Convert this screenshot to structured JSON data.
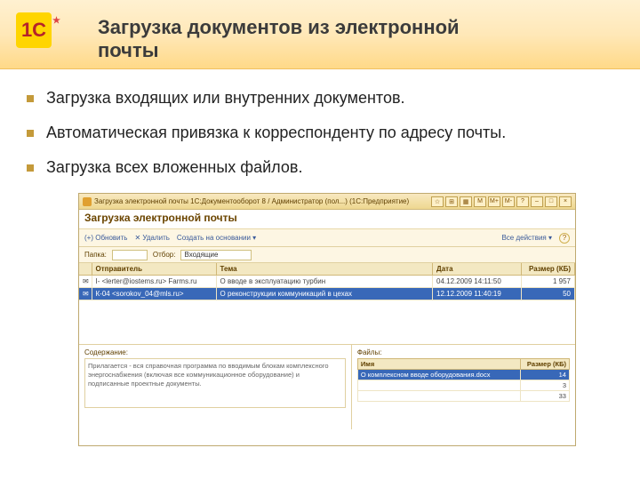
{
  "header": {
    "logo_text": "1С",
    "title_line1": "Загрузка документов из электронной",
    "title_line2": "почты"
  },
  "bullets": [
    "Загрузка входящих или внутренних документов.",
    "Автоматическая привязка к корреспонденту по адресу почты.",
    "Загрузка всех вложенных файлов."
  ],
  "screenshot": {
    "titlebar": "Загрузка электронной почты    1С:Документооборот 8 / Администратор (пол...)    (1С:Предприятие)",
    "titlebar_buttons": [
      "☆",
      "⊞",
      "▦",
      "M",
      "M+",
      "M-",
      "?",
      "–",
      "□",
      "×"
    ],
    "heading": "Загрузка электронной почты",
    "toolbar": {
      "btn1": "(+) Обновить",
      "btn2": "✕ Удалить",
      "btn3": "Создать на основании ▾",
      "right": "Все действия ▾"
    },
    "filter": {
      "label1": "Папка:",
      "label2": "Отбор:",
      "value2": "Входящие"
    },
    "columns": [
      "",
      "Отправитель",
      "Тема",
      "Дата",
      "Размер (КБ)"
    ],
    "rows": [
      {
        "icon": "✉",
        "from": "I- <lerter@iostems.ru> Farms.ru",
        "subj": "О вводе в эксплуатацию турбин",
        "date": "04.12.2009 14:11:50",
        "size": "1 957"
      },
      {
        "icon": "✉",
        "from": "К-04 <sorokov_04@mls.ru>",
        "subj": "О реконструкции коммуникаций в цехах",
        "date": "12.12.2009 11:40:19",
        "size": "50"
      }
    ],
    "desc_label": "Содержание:",
    "desc_text": "Прилагается - вся справочная программа по вводимым блокам комплексного энергоснабжения (включая все коммуникационное оборудование) и подписанные проектные документы.",
    "files_label": "Файлы:",
    "files_cols": [
      "Имя",
      "Размер (КБ)"
    ],
    "files": [
      {
        "name": "О комплексном вводе оборудования.docx",
        "size": "14"
      },
      {
        "name": "",
        "size": "3"
      },
      {
        "name": "",
        "size": "33"
      }
    ]
  }
}
